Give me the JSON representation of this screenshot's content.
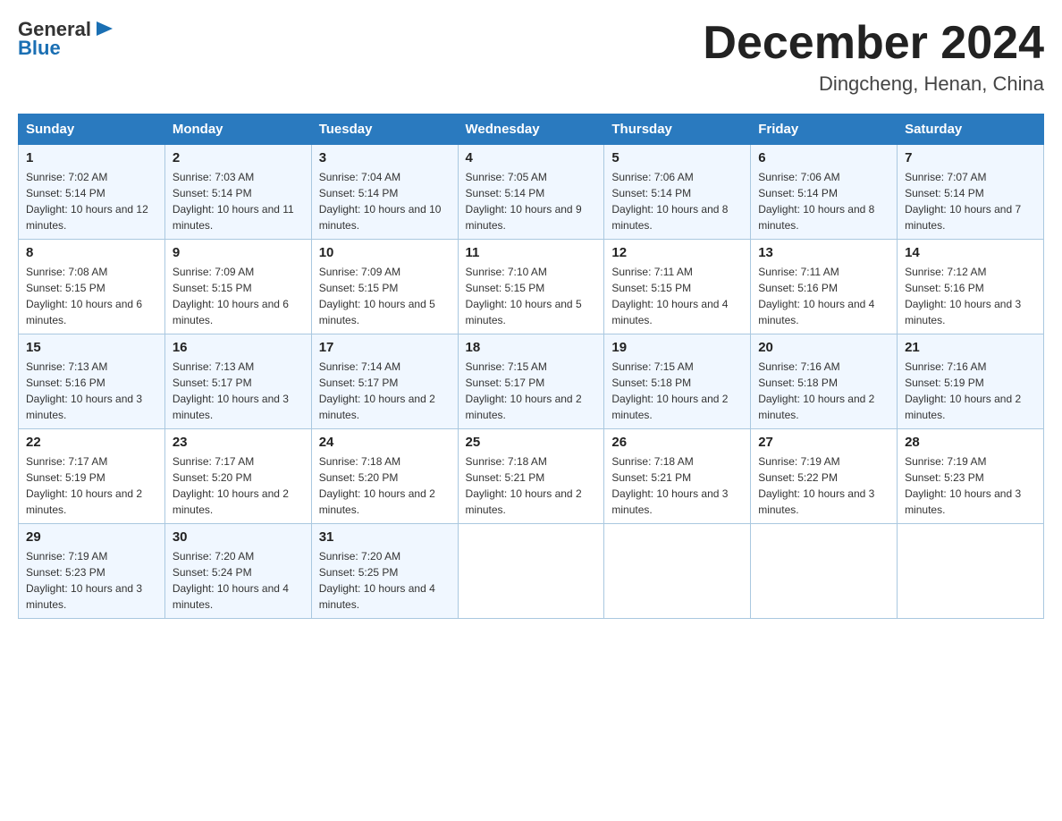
{
  "header": {
    "logo_general": "General",
    "logo_blue": "Blue",
    "title": "December 2024",
    "location": "Dingcheng, Henan, China"
  },
  "days_of_week": [
    "Sunday",
    "Monday",
    "Tuesday",
    "Wednesday",
    "Thursday",
    "Friday",
    "Saturday"
  ],
  "weeks": [
    [
      {
        "day": "1",
        "sunrise": "7:02 AM",
        "sunset": "5:14 PM",
        "daylight": "10 hours and 12 minutes."
      },
      {
        "day": "2",
        "sunrise": "7:03 AM",
        "sunset": "5:14 PM",
        "daylight": "10 hours and 11 minutes."
      },
      {
        "day": "3",
        "sunrise": "7:04 AM",
        "sunset": "5:14 PM",
        "daylight": "10 hours and 10 minutes."
      },
      {
        "day": "4",
        "sunrise": "7:05 AM",
        "sunset": "5:14 PM",
        "daylight": "10 hours and 9 minutes."
      },
      {
        "day": "5",
        "sunrise": "7:06 AM",
        "sunset": "5:14 PM",
        "daylight": "10 hours and 8 minutes."
      },
      {
        "day": "6",
        "sunrise": "7:06 AM",
        "sunset": "5:14 PM",
        "daylight": "10 hours and 8 minutes."
      },
      {
        "day": "7",
        "sunrise": "7:07 AM",
        "sunset": "5:14 PM",
        "daylight": "10 hours and 7 minutes."
      }
    ],
    [
      {
        "day": "8",
        "sunrise": "7:08 AM",
        "sunset": "5:15 PM",
        "daylight": "10 hours and 6 minutes."
      },
      {
        "day": "9",
        "sunrise": "7:09 AM",
        "sunset": "5:15 PM",
        "daylight": "10 hours and 6 minutes."
      },
      {
        "day": "10",
        "sunrise": "7:09 AM",
        "sunset": "5:15 PM",
        "daylight": "10 hours and 5 minutes."
      },
      {
        "day": "11",
        "sunrise": "7:10 AM",
        "sunset": "5:15 PM",
        "daylight": "10 hours and 5 minutes."
      },
      {
        "day": "12",
        "sunrise": "7:11 AM",
        "sunset": "5:15 PM",
        "daylight": "10 hours and 4 minutes."
      },
      {
        "day": "13",
        "sunrise": "7:11 AM",
        "sunset": "5:16 PM",
        "daylight": "10 hours and 4 minutes."
      },
      {
        "day": "14",
        "sunrise": "7:12 AM",
        "sunset": "5:16 PM",
        "daylight": "10 hours and 3 minutes."
      }
    ],
    [
      {
        "day": "15",
        "sunrise": "7:13 AM",
        "sunset": "5:16 PM",
        "daylight": "10 hours and 3 minutes."
      },
      {
        "day": "16",
        "sunrise": "7:13 AM",
        "sunset": "5:17 PM",
        "daylight": "10 hours and 3 minutes."
      },
      {
        "day": "17",
        "sunrise": "7:14 AM",
        "sunset": "5:17 PM",
        "daylight": "10 hours and 2 minutes."
      },
      {
        "day": "18",
        "sunrise": "7:15 AM",
        "sunset": "5:17 PM",
        "daylight": "10 hours and 2 minutes."
      },
      {
        "day": "19",
        "sunrise": "7:15 AM",
        "sunset": "5:18 PM",
        "daylight": "10 hours and 2 minutes."
      },
      {
        "day": "20",
        "sunrise": "7:16 AM",
        "sunset": "5:18 PM",
        "daylight": "10 hours and 2 minutes."
      },
      {
        "day": "21",
        "sunrise": "7:16 AM",
        "sunset": "5:19 PM",
        "daylight": "10 hours and 2 minutes."
      }
    ],
    [
      {
        "day": "22",
        "sunrise": "7:17 AM",
        "sunset": "5:19 PM",
        "daylight": "10 hours and 2 minutes."
      },
      {
        "day": "23",
        "sunrise": "7:17 AM",
        "sunset": "5:20 PM",
        "daylight": "10 hours and 2 minutes."
      },
      {
        "day": "24",
        "sunrise": "7:18 AM",
        "sunset": "5:20 PM",
        "daylight": "10 hours and 2 minutes."
      },
      {
        "day": "25",
        "sunrise": "7:18 AM",
        "sunset": "5:21 PM",
        "daylight": "10 hours and 2 minutes."
      },
      {
        "day": "26",
        "sunrise": "7:18 AM",
        "sunset": "5:21 PM",
        "daylight": "10 hours and 3 minutes."
      },
      {
        "day": "27",
        "sunrise": "7:19 AM",
        "sunset": "5:22 PM",
        "daylight": "10 hours and 3 minutes."
      },
      {
        "day": "28",
        "sunrise": "7:19 AM",
        "sunset": "5:23 PM",
        "daylight": "10 hours and 3 minutes."
      }
    ],
    [
      {
        "day": "29",
        "sunrise": "7:19 AM",
        "sunset": "5:23 PM",
        "daylight": "10 hours and 3 minutes."
      },
      {
        "day": "30",
        "sunrise": "7:20 AM",
        "sunset": "5:24 PM",
        "daylight": "10 hours and 4 minutes."
      },
      {
        "day": "31",
        "sunrise": "7:20 AM",
        "sunset": "5:25 PM",
        "daylight": "10 hours and 4 minutes."
      },
      null,
      null,
      null,
      null
    ]
  ],
  "sunrise_label": "Sunrise:",
  "sunset_label": "Sunset:",
  "daylight_label": "Daylight:"
}
